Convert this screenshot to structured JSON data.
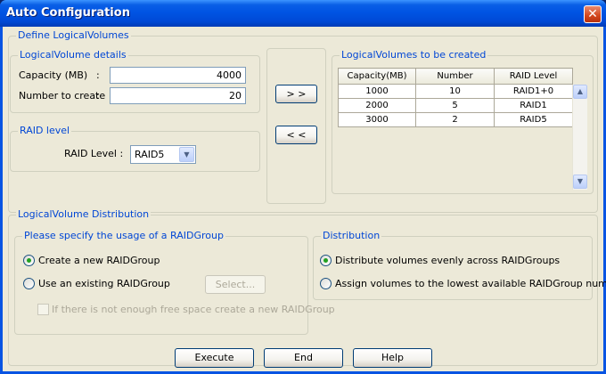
{
  "window": {
    "title": "Auto Configuration",
    "close": "✕"
  },
  "define": {
    "title": "Define LogicalVolumes",
    "details": {
      "title": "LogicalVolume details",
      "capacity_label": "Capacity (MB)",
      "capacity_colon": ":",
      "capacity_value": "4000",
      "number_label": "Number to create",
      "number_colon": ":",
      "number_value": "20"
    },
    "raid": {
      "title": "RAID level",
      "label": "RAID Level :",
      "selected": "RAID5",
      "arrow": "▼"
    },
    "add_label": "> >",
    "remove_label": "< <",
    "created": {
      "title": "LogicalVolumes to be created",
      "columns": [
        "Capacity(MB)",
        "Number",
        "RAID Level"
      ],
      "rows": [
        [
          "1000",
          "10",
          "RAID1+0"
        ],
        [
          "2000",
          "5",
          "RAID1"
        ],
        [
          "3000",
          "2",
          "RAID5"
        ]
      ],
      "scroll_up": "▲",
      "scroll_down": "▼"
    }
  },
  "distribution": {
    "title": "LogicalVolume Distribution",
    "usage": {
      "title": "Please specify the usage of a RAIDGroup",
      "create_new": "Create a new RAIDGroup",
      "use_existing": "Use an existing RAIDGroup",
      "select_button": "Select...",
      "fallback": "If there is not enough free space create a new RAIDGroup"
    },
    "dist": {
      "title": "Distribution",
      "evenly": "Distribute volumes evenly across RAIDGroups",
      "lowest": "Assign volumes to the lowest available RAIDGroup number"
    }
  },
  "buttons": {
    "execute": "Execute",
    "end": "End",
    "help": "Help"
  }
}
